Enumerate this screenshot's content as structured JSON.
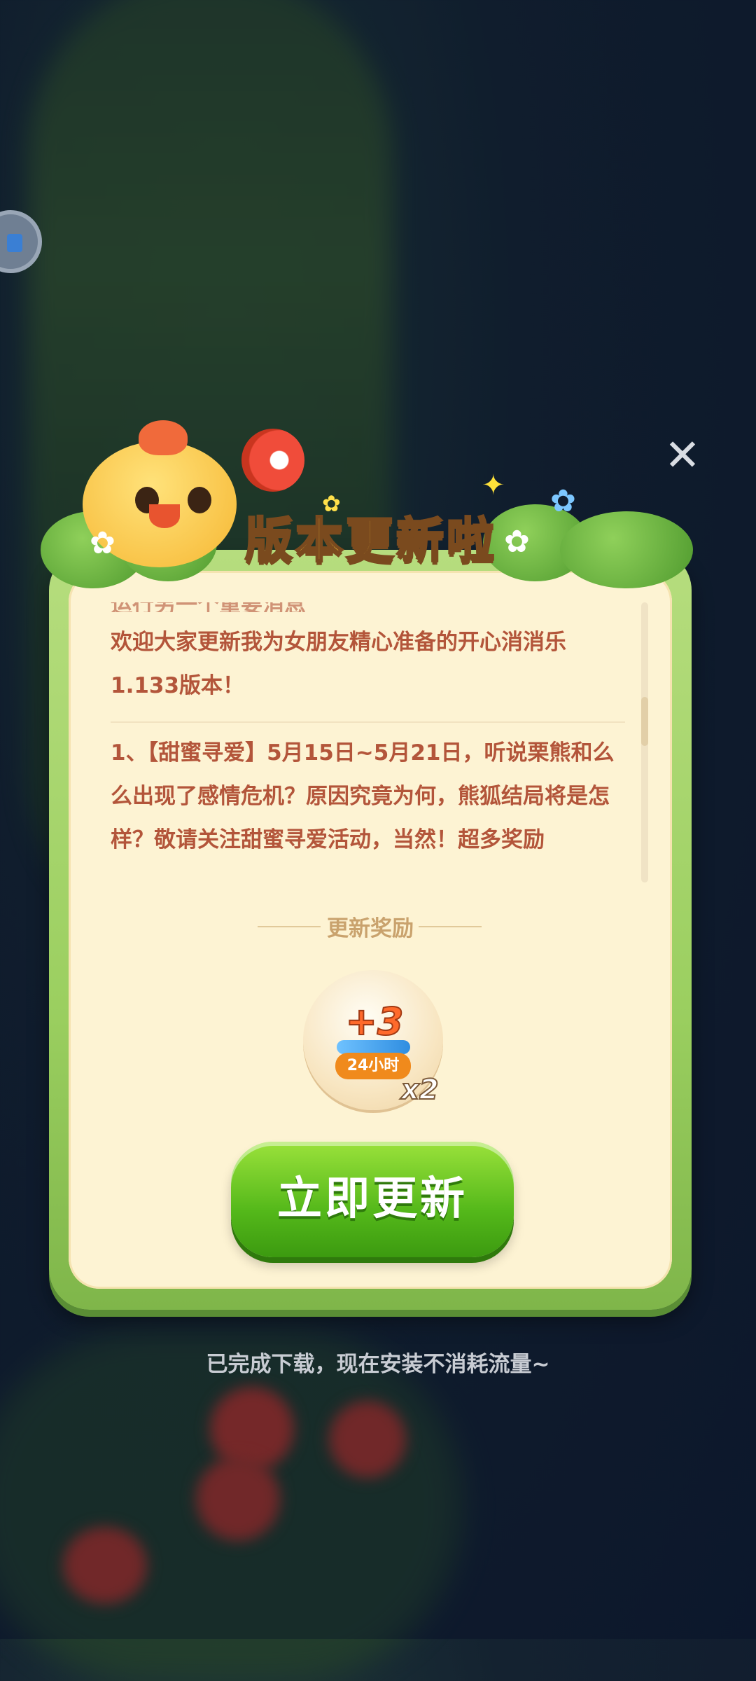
{
  "dialog": {
    "title": "版本更新啦",
    "notes": {
      "cut_top": "运行另一个重要消息",
      "intro": "欢迎大家更新我为女朋友精心准备的开心消消乐1.133版本！",
      "item1": "1、【甜蜜寻爱】5月15日~5月21日，听说栗熊和么么出现了感情危机？原因究竟为何，熊狐结局将是怎样？敬请关注甜蜜寻爱活动，当然！超多奖励"
    },
    "reward_section_title": "更新奖励",
    "reward": {
      "amount": "+3",
      "duration": "24小时",
      "count": "x2"
    },
    "update_button": "立即更新",
    "close_icon": "✕"
  },
  "footer": {
    "hint": "已完成下载，现在安装不消耗流量~"
  },
  "colors": {
    "panel": "#fdf3d3",
    "dialog_border": "#9bcf60",
    "text": "#b3553a",
    "button": "#54b81a"
  }
}
